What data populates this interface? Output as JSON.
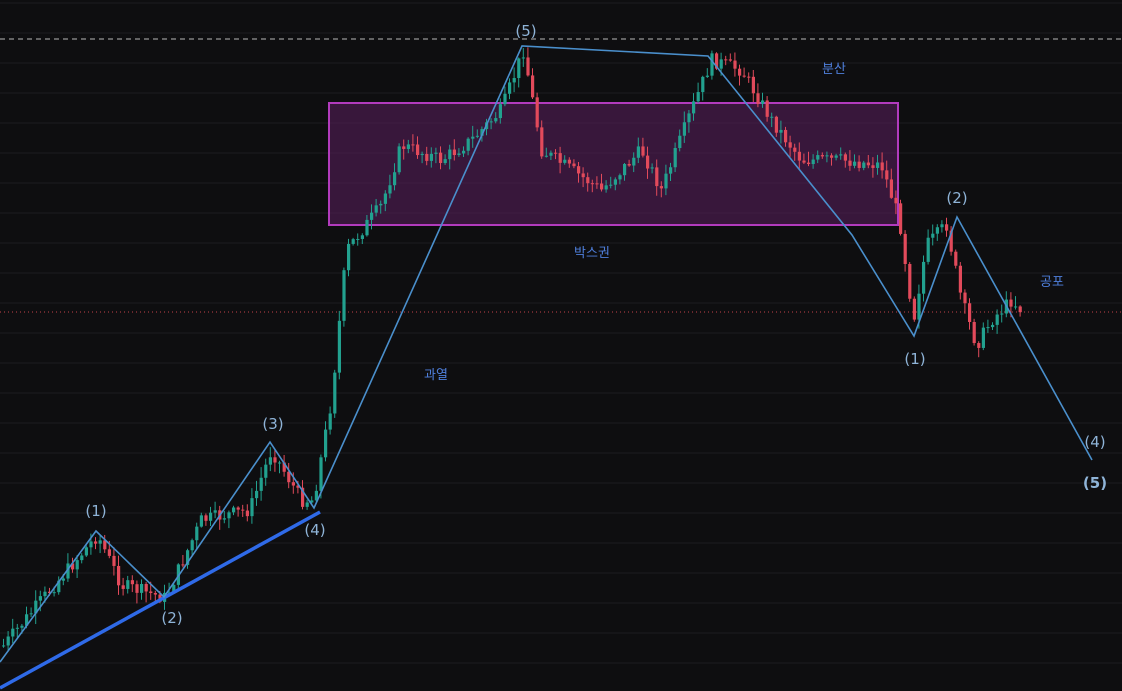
{
  "colors": {
    "background": "#0e0e10",
    "grid": "#1c1c1f",
    "bull": "#22a18f",
    "bear": "#e24a5b",
    "wave_line": "#4a8fcc",
    "trend_line": "#2f6ae8",
    "box_fill": "#5b1f5e",
    "box_stroke": "#b23bbd",
    "wave_label": "#8fb4d8",
    "annotation": "#4f7fdc",
    "top_dash": "#b8b8b8",
    "price_dot": "#c2414a"
  },
  "chart_data": {
    "type": "candlestick",
    "title": "",
    "xlabel": "",
    "ylabel": "",
    "grid": true,
    "wave_labels": [
      {
        "text": "(1)",
        "bold": false
      },
      {
        "text": "(2)",
        "bold": false
      },
      {
        "text": "(3)",
        "bold": false
      },
      {
        "text": "(4)",
        "bold": false
      },
      {
        "text": "(5)",
        "bold": false
      },
      {
        "text": "(1)",
        "bold": false
      },
      {
        "text": "(2)",
        "bold": false
      },
      {
        "text": "(4)",
        "bold": false
      },
      {
        "text": "(5)",
        "bold": true
      }
    ],
    "annotations": [
      {
        "text": "과열"
      },
      {
        "text": "박스권"
      },
      {
        "text": "분산"
      },
      {
        "text": "공포"
      }
    ]
  }
}
